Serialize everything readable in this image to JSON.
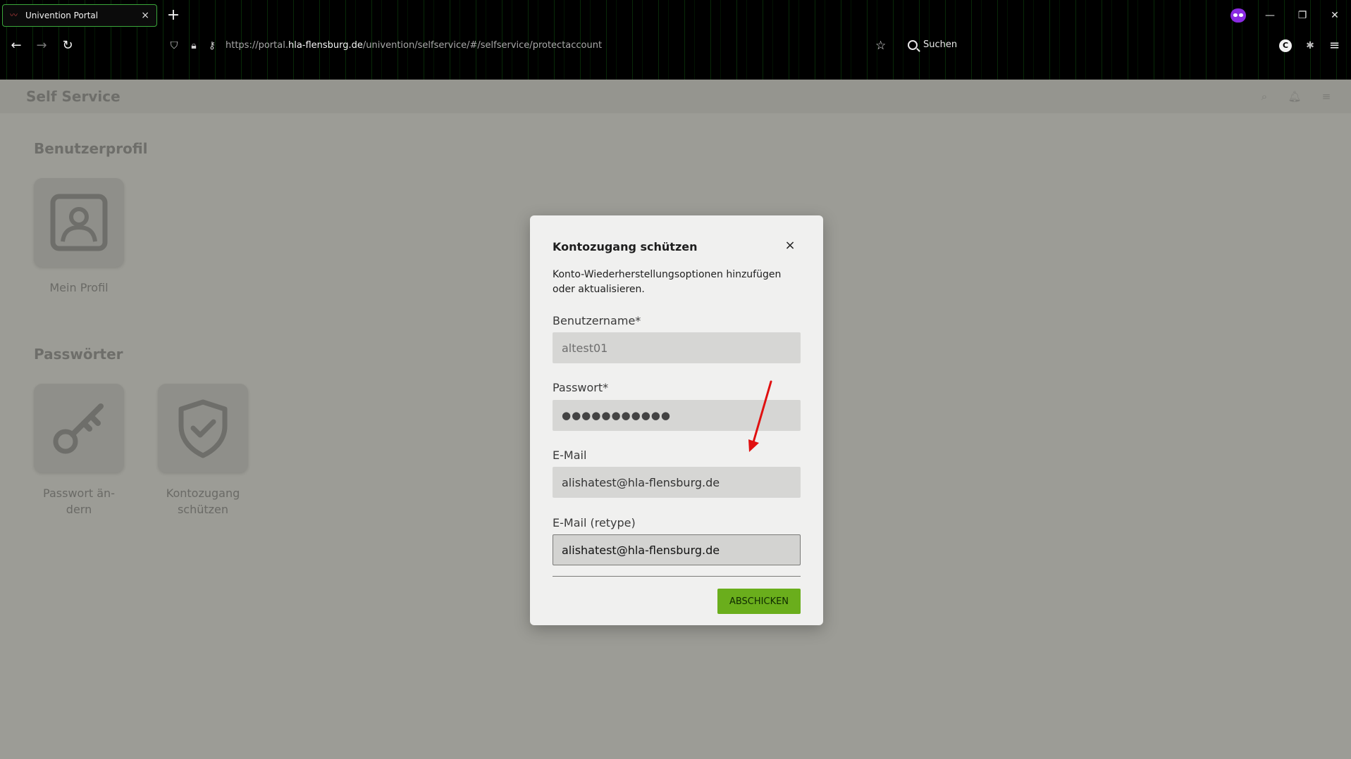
{
  "browser": {
    "tab_title": "Univention Portal",
    "tab_close": "×",
    "new_tab": "+",
    "url_host_prefix": "https://portal.",
    "url_host": "hla-flensburg.de",
    "url_path": "/univention/selfservice/#/selfservice/protectaccount",
    "search_label": "Suchen",
    "ext_label": "C"
  },
  "app": {
    "title": "Self Service"
  },
  "sections": {
    "profile_title": "Benutzerprofil",
    "profile_tile_label": "Mein Profil",
    "passwords_title": "Passwörter",
    "password_tile_label_line1": "Passwort än-",
    "password_tile_label_line2": "dern",
    "protect_tile_label_line1": "Kontozugang",
    "protect_tile_label_line2": "schützen"
  },
  "modal": {
    "title": "Kontozugang schützen",
    "close": "×",
    "description": "Konto-Wiederherstellungsoptionen hinzufügen oder aktualisieren.",
    "username_label": "Benutzername*",
    "username_value": "altest01",
    "password_label": "Passwort*",
    "password_value": "●●●●●●●●●●●",
    "email_label": "E-Mail",
    "email_value": "alishatest@hla-flensburg.de",
    "email_retype_label": "E-Mail (retype)",
    "email_retype_value": "alishatest@hla-flensburg.de",
    "submit_label": "ABSCHICKEN"
  },
  "colors": {
    "submit": "#6aae1c",
    "annotation_arrow": "#e01010"
  }
}
